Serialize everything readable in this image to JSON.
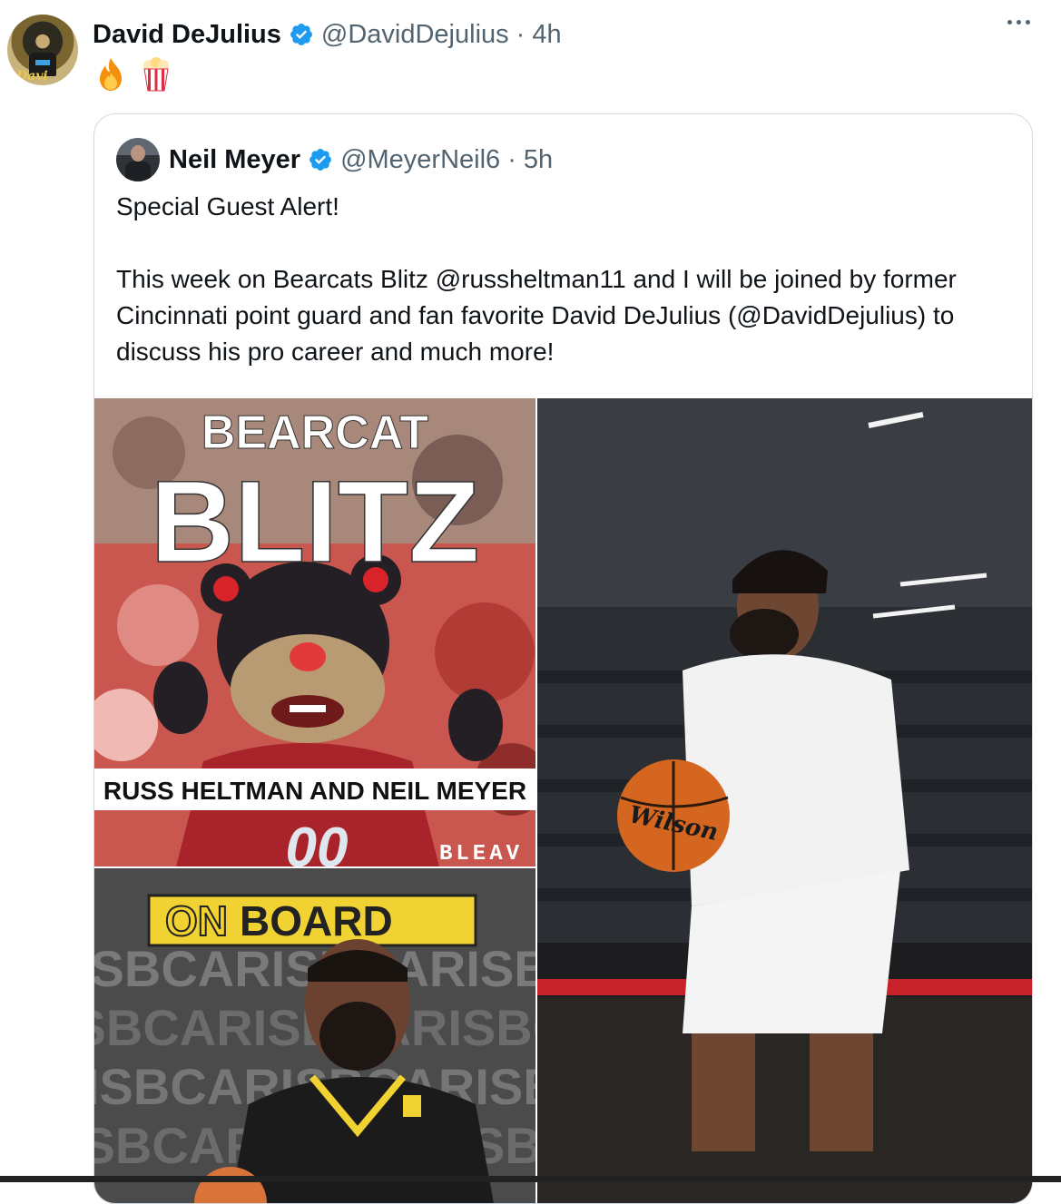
{
  "tweet": {
    "author_name": "David DeJulius",
    "author_handle": "@DavidDejulius",
    "separator": "·",
    "time": "4h",
    "verified": true,
    "emojis": [
      "fire-emoji",
      "popcorn-emoji"
    ],
    "more_icon": "more-horizontal-icon"
  },
  "quoted": {
    "author_name": "Neil Meyer",
    "author_handle": "@MeyerNeil6",
    "separator": "·",
    "time": "5h",
    "verified": true,
    "text_line1": "Special Guest Alert!",
    "text_para2": "This week on Bearcats Blitz @russheltman11 and I will be joined by former Cincinnati point guard and fan favorite David DeJulius (@DavidDejulius) to discuss his pro career and much more!",
    "media": {
      "top_left": {
        "title_small": "BEARCAT",
        "title_big": "BLITZ",
        "subtitle": "RUSS HELTMAN AND NEIL MEYER",
        "number": "00",
        "watermark": "BLEAV"
      },
      "bottom_left": {
        "banner_outline": "ON",
        "banner_solid": "BOARD",
        "bg_text": "ISBCARISBCARISBCARISBCARIS"
      },
      "right": {
        "ball_brand": "Wilson"
      }
    }
  },
  "colors": {
    "verified_blue": "#1d9bf0",
    "muted_text": "#536471",
    "border": "#cfd9de"
  }
}
